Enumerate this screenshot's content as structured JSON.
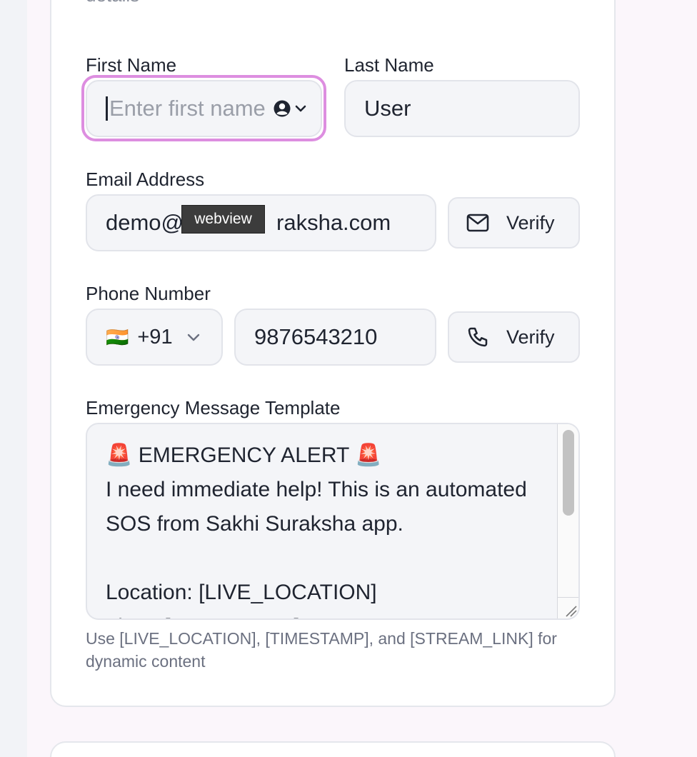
{
  "form": {
    "section_desc": "details",
    "first_name": {
      "label": "First Name",
      "placeholder": "Enter first name",
      "value": ""
    },
    "last_name": {
      "label": "Last Name",
      "value": "User"
    },
    "email": {
      "label": "Email Address",
      "value_prefix": "demo@",
      "value_suffix": "raksha.com",
      "verify_label": "Verify"
    },
    "tooltip": "webview",
    "phone": {
      "label": "Phone Number",
      "country_flag": "🇮🇳",
      "country_code": "+91",
      "value": "9876543210",
      "verify_label": "Verify"
    },
    "template": {
      "label": "Emergency Message Template",
      "text": "🚨 EMERGENCY ALERT 🚨\nI need immediate help! This is an automated SOS from Sakhi Suraksha app.\n\nLocation: [LIVE_LOCATION]\nTime: [TIMESTAMP]",
      "hint": "Use [LIVE_LOCATION], [TIMESTAMP], and [STREAM_LINK] for dynamic content"
    }
  },
  "icons": {
    "autofill": "contact-autofill-icon",
    "mail": "mail-icon",
    "phone": "phone-icon",
    "chevron": "chevron-down-icon"
  },
  "colors": {
    "focus_ring": "#dd8ee0",
    "field_bg": "#f4f5f8"
  }
}
